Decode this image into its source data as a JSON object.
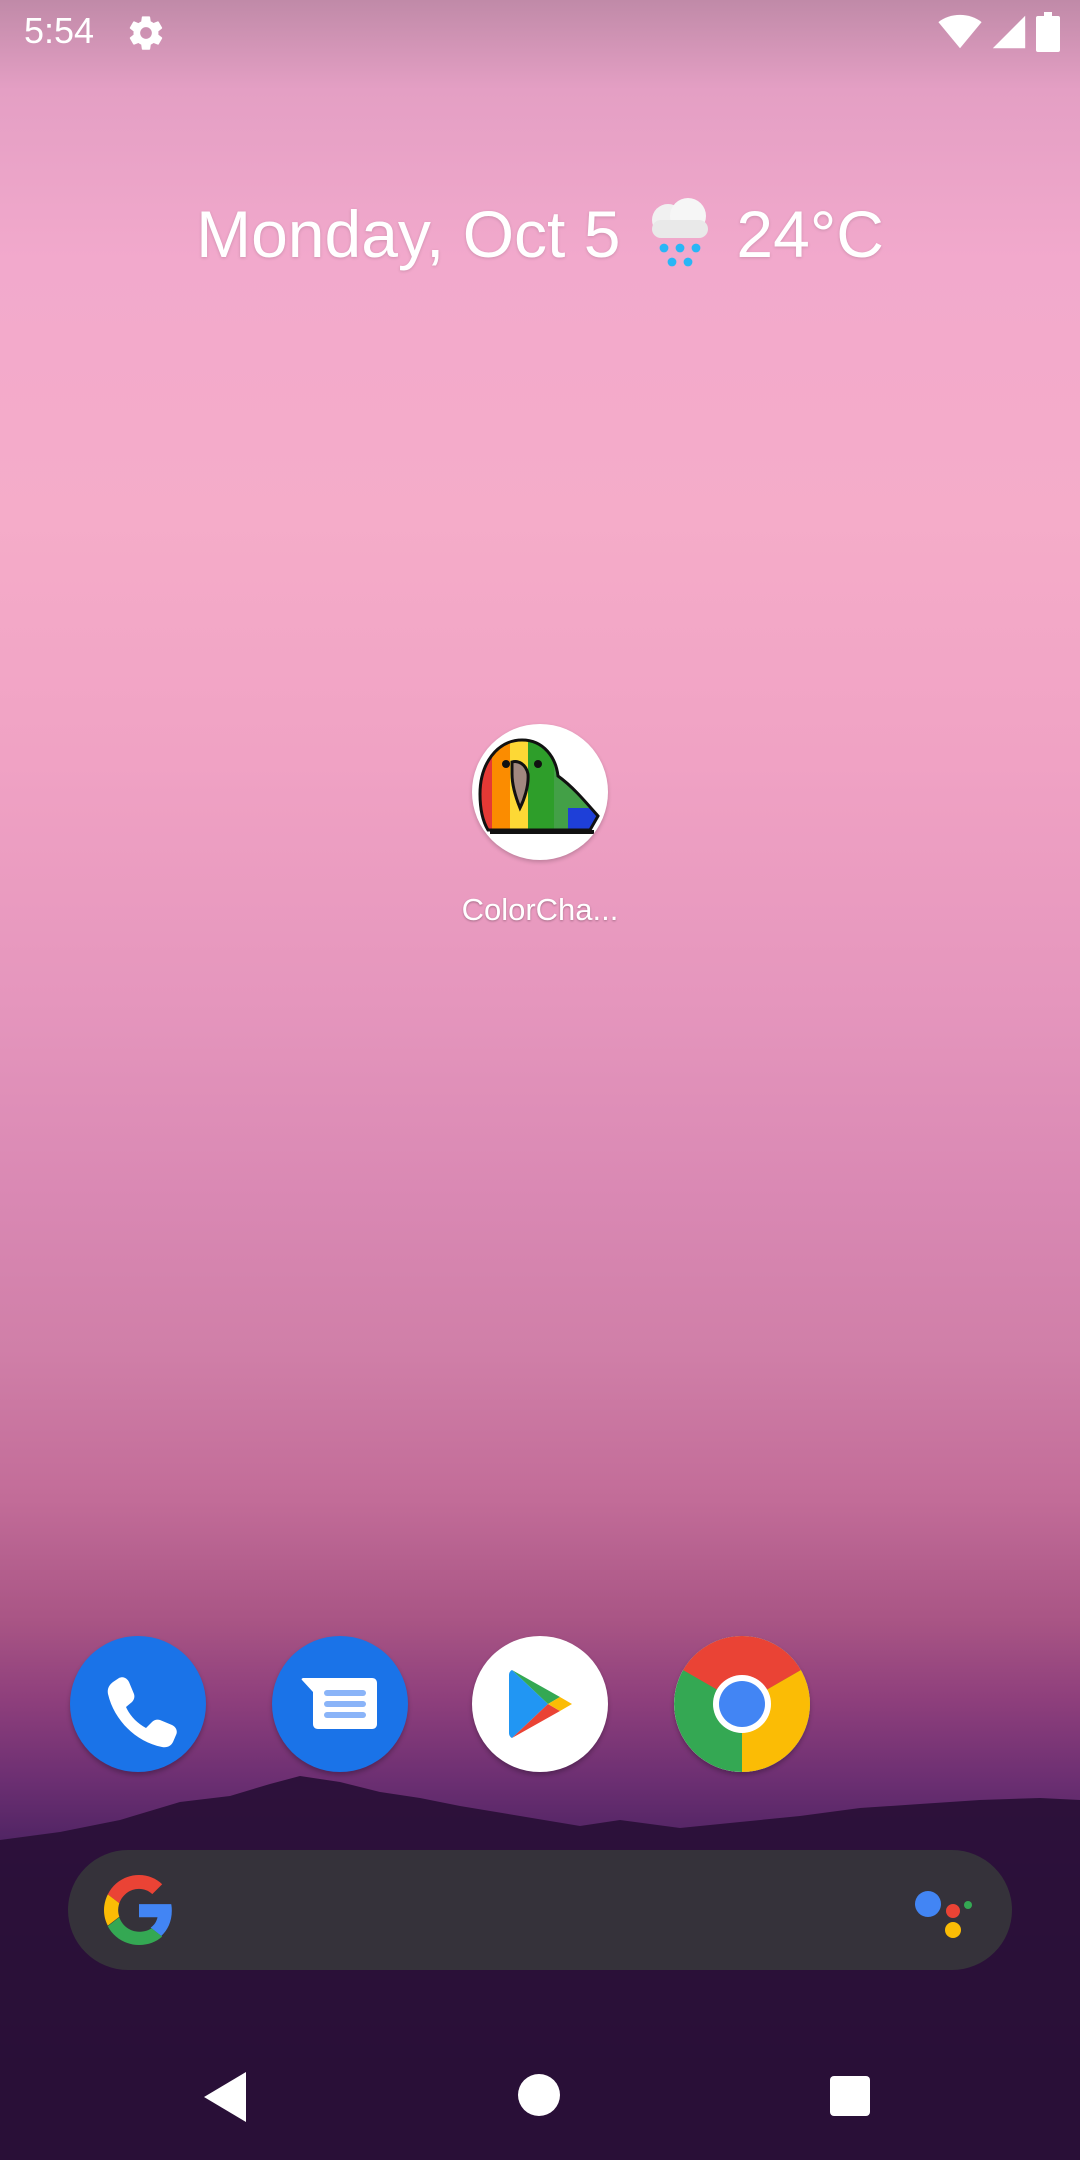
{
  "status_bar": {
    "time": "5:54",
    "icons": [
      "settings-gear-icon",
      "wifi-icon",
      "cellular-signal-icon",
      "battery-icon"
    ]
  },
  "at_a_glance": {
    "date": "Monday, Oct 5",
    "weather_icon": "rain-cloud-icon",
    "temperature": "24°C"
  },
  "home_apps": [
    {
      "label": "ColorCha...",
      "icon": "rainbow-parrot-icon"
    }
  ],
  "dock": [
    {
      "name": "Phone",
      "icon": "phone-icon"
    },
    {
      "name": "Messages",
      "icon": "messages-icon"
    },
    {
      "name": "Play Store",
      "icon": "play-store-icon"
    },
    {
      "name": "Chrome",
      "icon": "chrome-icon"
    }
  ],
  "search_bar": {
    "left_icon": "google-g-icon",
    "right_icon": "google-assistant-icon"
  },
  "nav_bar": {
    "buttons": [
      "back-icon",
      "home-icon",
      "recents-icon"
    ]
  },
  "colors": {
    "dock_blue": "#1a73e8",
    "search_bar": "#35323a",
    "google_blue": "#4285f4",
    "google_red": "#ea4335",
    "google_yellow": "#fbbc05",
    "google_green": "#34a853"
  }
}
